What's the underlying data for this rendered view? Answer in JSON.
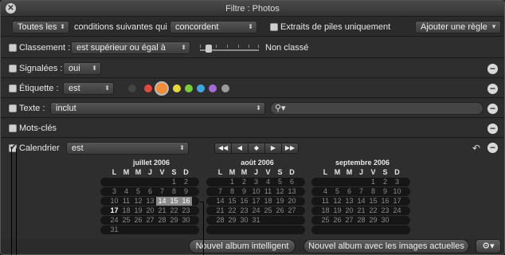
{
  "window": {
    "title": "Filtre : Photos"
  },
  "header": {
    "match_mode": "Toutes les",
    "conditions_text": "conditions suivantes qui",
    "agree_mode": "concordent",
    "stacks_only_label": "Extraits de piles uniquement",
    "add_rule": "Ajouter une règle"
  },
  "rules": {
    "rating": {
      "label": "Classement :",
      "operator": "est supérieur ou égal à",
      "value": "Non classé"
    },
    "flagged": {
      "label": "Signalées :",
      "value": "oui"
    },
    "color_label": {
      "label": "Étiquette :",
      "operator": "est",
      "colors": [
        "#444444",
        "#e0473e",
        "#f08c3a",
        "#e5d83a",
        "#7acb3e",
        "#3fa6e6",
        "#a56ad8",
        "#9a9a9a"
      ]
    },
    "text": {
      "label": "Texte :",
      "operator": "inclut",
      "search_value": ""
    },
    "keywords": {
      "label": "Mots-clés"
    },
    "calendar": {
      "label": "Calendrier",
      "operator": "est"
    }
  },
  "calendar": {
    "weekday_headers": [
      "L",
      "M",
      "M",
      "J",
      "V",
      "S",
      "D"
    ],
    "months": [
      {
        "title": "juillet 2006",
        "rows": [
          [
            "",
            "",
            "",
            "",
            "",
            "1",
            "2"
          ],
          [
            "3",
            "4",
            "5",
            "6",
            "7",
            "8",
            "9"
          ],
          [
            "10",
            "11",
            "12",
            "13",
            "14",
            "15",
            "16"
          ],
          [
            "17",
            "18",
            "19",
            "20",
            "21",
            "22",
            "23"
          ],
          [
            "24",
            "25",
            "26",
            "27",
            "28",
            "29",
            "30"
          ],
          [
            "31",
            "",
            "",
            "",
            "",
            "",
            ""
          ]
        ]
      },
      {
        "title": "août 2006",
        "rows": [
          [
            "",
            "1",
            "2",
            "3",
            "4",
            "5",
            "6"
          ],
          [
            "7",
            "8",
            "9",
            "10",
            "11",
            "12",
            "13"
          ],
          [
            "14",
            "15",
            "16",
            "17",
            "18",
            "19",
            "20"
          ],
          [
            "21",
            "22",
            "23",
            "24",
            "25",
            "26",
            "27"
          ],
          [
            "28",
            "29",
            "30",
            "31",
            "",
            "",
            ""
          ]
        ]
      },
      {
        "title": "septembre 2006",
        "rows": [
          [
            "",
            "",
            "",
            "",
            "1",
            "2",
            "3"
          ],
          [
            "4",
            "5",
            "6",
            "7",
            "8",
            "9",
            "10"
          ],
          [
            "11",
            "12",
            "13",
            "14",
            "15",
            "16",
            "17"
          ],
          [
            "18",
            "19",
            "20",
            "21",
            "22",
            "23",
            "24"
          ],
          [
            "25",
            "26",
            "27",
            "28",
            "29",
            "30",
            ""
          ]
        ]
      }
    ]
  },
  "footer": {
    "new_smart_album": "Nouvel album intelligent",
    "new_album_current": "Nouvel album avec les images actuelles"
  }
}
